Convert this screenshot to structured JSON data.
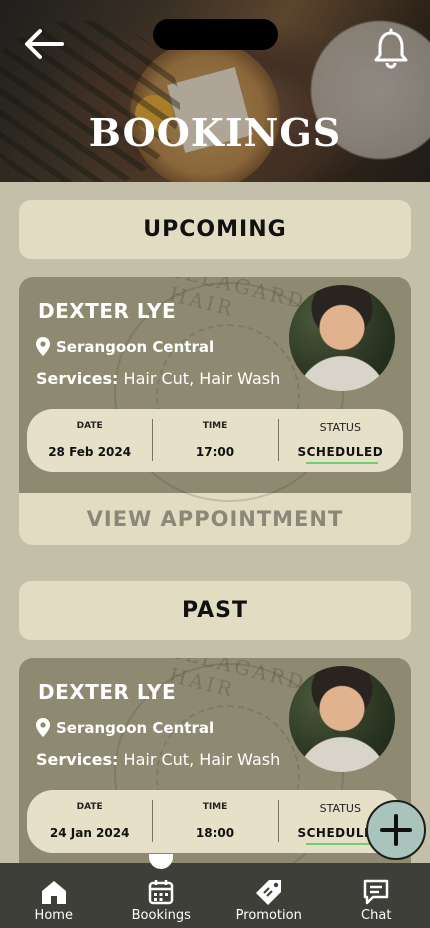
{
  "header": {
    "title": "BOOKINGS",
    "back_icon": "arrow-left-icon",
    "notification_icon": "bell-icon"
  },
  "sections": {
    "upcoming_label": "UPCOMING",
    "past_label": "PAST"
  },
  "upcoming": [
    {
      "name": "DEXTER LYE",
      "location": "Serangoon Central",
      "services_label": "Services:",
      "services": "Hair Cut, Hair Wash",
      "date_label": "DATE",
      "date": "28 Feb 2024",
      "time_label": "TIME",
      "time": "17:00",
      "status_label": "STATUS",
      "status": "SCHEDULED",
      "action_label": "VIEW APPOINTMENT"
    }
  ],
  "past": [
    {
      "name": "DEXTER LYE",
      "location": "Serangoon Central",
      "services_label": "Services:",
      "services": "Hair Cut, Hair Wash",
      "date_label": "DATE",
      "date": "24 Jan 2024",
      "time_label": "TIME",
      "time": "18:00",
      "status_label": "STATUS",
      "status": "SCHEDULED"
    }
  ],
  "watermark_text": "ILLAGARDEN HAIR",
  "nav": {
    "items": [
      {
        "label": "Home",
        "icon": "home-icon"
      },
      {
        "label": "Bookings",
        "icon": "calendar-icon",
        "active": true
      },
      {
        "label": "Promotion",
        "icon": "tag-icon"
      },
      {
        "label": "Chat",
        "icon": "chat-icon"
      }
    ]
  },
  "colors": {
    "background": "#c4bfa8",
    "card": "#8d8a71",
    "pill": "#e2dcc3",
    "nav": "#3e3f38",
    "fab": "#a9c4bd",
    "status_underline": "#6fcf6f"
  }
}
